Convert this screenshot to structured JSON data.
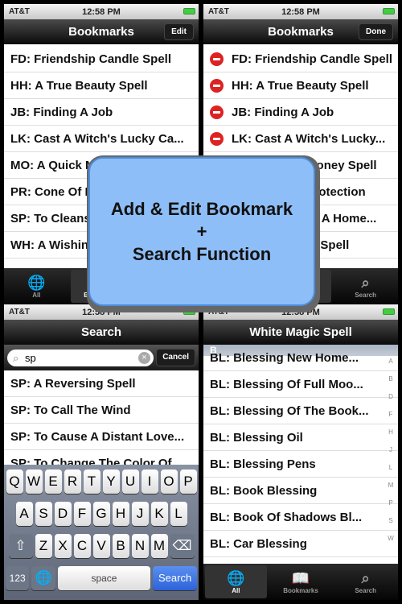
{
  "status": {
    "carrier": "AT&T",
    "time": "12:58 PM"
  },
  "overlay": {
    "line1": "Add & Edit Bookmark",
    "line2": "+",
    "line3": "Search Function"
  },
  "bookmarks": {
    "title": "Bookmarks",
    "edit": "Edit",
    "done": "Done",
    "items": [
      "FD: Friendship Candle Spell",
      "HH: A True Beauty Spell",
      "JB: Finding A Job",
      "LK: Cast A Witch's Lucky Ca...",
      "MO: A Quick Money Spell",
      "PR: Cone Of Protection",
      "SP: To Cleanse A Home...",
      "WH: A Wishing Spell"
    ],
    "items_edit": [
      "FD: Friendship Candle Spell",
      "HH: A True Beauty Spell",
      "JB: Finding A Job",
      "LK: Cast A Witch's Lucky...",
      "MO: A Quick Money Spell",
      "PR: Cone Of Protection",
      "SP: To Cleanse A Home...",
      "WH: A Wishing Spell"
    ]
  },
  "tabs": {
    "all": "All",
    "bookmarks": "Bookmarks",
    "search": "Search"
  },
  "search": {
    "title": "Search",
    "query": "sp",
    "cancel": "Cancel",
    "results": [
      "SP: A Reversing Spell",
      "SP: To Call The Wind",
      "SP: To Cause A Distant Love...",
      "SP: To Change The Color Of..."
    ]
  },
  "keyboard": {
    "row1": [
      "Q",
      "W",
      "E",
      "R",
      "T",
      "Y",
      "U",
      "I",
      "O",
      "P"
    ],
    "row2": [
      "A",
      "S",
      "D",
      "F",
      "G",
      "H",
      "J",
      "K",
      "L"
    ],
    "row3": [
      "Z",
      "X",
      "C",
      "V",
      "B",
      "N",
      "M"
    ],
    "num": "123",
    "space": "space",
    "go": "Search"
  },
  "white": {
    "title": "White Magic Spell",
    "section": "B",
    "items": [
      "BL: Blessing New Home...",
      "BL: Blessing Of Full Moo...",
      "BL: Blessing Of The Book...",
      "BL: Blessing Oil",
      "BL: Blessing Pens",
      "BL: Book Blessing",
      "BL: Book Of Shadows Bl...",
      "BL: Car Blessing"
    ],
    "index": [
      "A",
      "B",
      "D",
      "F",
      "H",
      "J",
      "L",
      "M",
      "P",
      "S",
      "W"
    ]
  }
}
